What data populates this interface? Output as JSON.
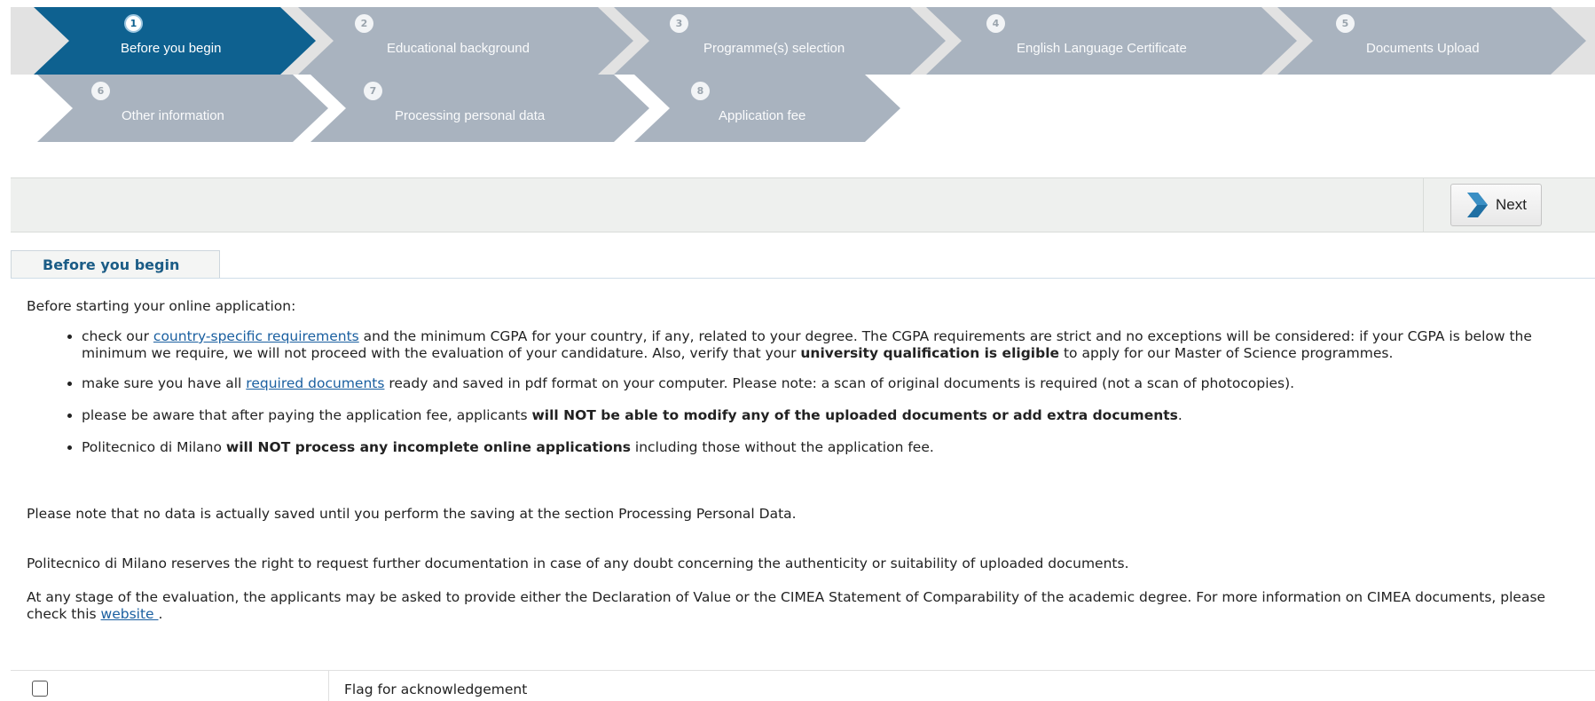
{
  "wizard": {
    "steps": [
      {
        "num": "1",
        "label": "Before you begin"
      },
      {
        "num": "2",
        "label": "Educational background"
      },
      {
        "num": "3",
        "label": "Programme(s) selection"
      },
      {
        "num": "4",
        "label": "English Language Certificate"
      },
      {
        "num": "5",
        "label": "Documents Upload"
      },
      {
        "num": "6",
        "label": "Other information"
      },
      {
        "num": "7",
        "label": "Processing personal data"
      },
      {
        "num": "8",
        "label": "Application fee"
      }
    ],
    "active_step": 1
  },
  "toolbar": {
    "next_label": "Next"
  },
  "tab": {
    "label": "Before you begin"
  },
  "content": {
    "intro": "Before starting your online application:",
    "bullet1": {
      "pre": "check our ",
      "link": "country-specific requirements",
      "mid": " and the minimum CGPA for your country, if any, related to your degree. The CGPA requirements are strict and no exceptions will be considered: if your CGPA is below the minimum we require, we will not proceed with the evaluation of your candidature. Also, verify that your ",
      "bold": "university qualification is eligible",
      "post": " to apply for our Master of Science programmes."
    },
    "bullet2": {
      "pre": "make sure you have all ",
      "link": "required documents",
      "post": " ready and saved in pdf format on your computer. Please note: a scan of original documents is required (not a scan of photocopies)."
    },
    "bullet3": {
      "pre": "please be aware that after paying the application fee, applicants ",
      "bold": "will NOT be able to modify any of the uploaded documents or add extra documents",
      "post": "."
    },
    "bullet4": {
      "pre": "Politecnico di Milano ",
      "bold": "will NOT process any incomplete online applications",
      "post": " including those without the application fee."
    },
    "note_saving": "Please note that no data is actually saved until you perform the saving at the section Processing Personal Data.",
    "note_rights": "Politecnico di Milano reserves the right to request further documentation in case of any doubt concerning the authenticity or suitability of uploaded documents.",
    "note_cimea": {
      "pre": "At any stage of the evaluation, the applicants may be asked to provide either the Declaration of Value or the CIMEA Statement of Comparability of the academic degree. For more information on CIMEA documents, please check this ",
      "link": "website ",
      "post": "."
    }
  },
  "acknowledgement": {
    "label": "Flag for acknowledgement",
    "checked": false
  },
  "colors": {
    "active_step": "#0e6190",
    "inactive_step": "#a9b3bf",
    "link": "#1a5fa0"
  }
}
